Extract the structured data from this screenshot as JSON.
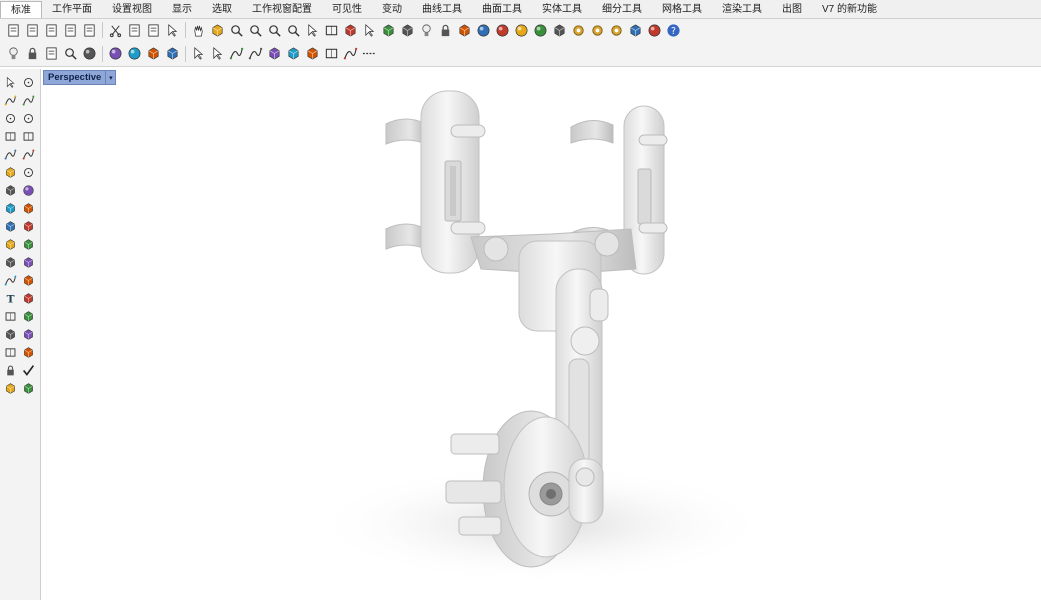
{
  "menu_tabs": [
    {
      "label": "标准",
      "active": true
    },
    {
      "label": "工作平面"
    },
    {
      "label": "设置视图"
    },
    {
      "label": "显示"
    },
    {
      "label": "选取"
    },
    {
      "label": "工作视窗配置"
    },
    {
      "label": "可见性"
    },
    {
      "label": "变动"
    },
    {
      "label": "曲线工具"
    },
    {
      "label": "曲面工具"
    },
    {
      "label": "实体工具"
    },
    {
      "label": "细分工具"
    },
    {
      "label": "网格工具"
    },
    {
      "label": "渲染工具"
    },
    {
      "label": "出图"
    },
    {
      "label": "V7 的新功能"
    }
  ],
  "toolbar_row1": [
    "new-file-icon",
    "open-file-icon",
    "save-icon",
    "print-icon",
    "import-icon",
    "cut-icon",
    "copy-icon",
    "paste-icon",
    "undo-icon",
    "pan-hand-icon",
    "rotate-view-icon",
    "zoom-icon",
    "zoom-window-icon",
    "zoom-extents-icon",
    "zoom-selected-icon",
    "undo-view-icon",
    "four-viewports-icon",
    "car-icon",
    "select-points-icon",
    "cplane-icon",
    "snap-icon",
    "light-bulb-icon",
    "lock-icon",
    "layer-icon",
    "color-wheel-icon",
    "sphere-icon",
    "shaded-sphere-icon",
    "render-sphere-icon",
    "material-icon",
    "gear-icon",
    "gear-options-icon",
    "gear-settings-icon",
    "dimension-icon",
    "globe-icon",
    "help-icon"
  ],
  "toolbar_row2": [
    "light-bulb-icon",
    "lock-icon",
    "save-icon",
    "zoom-extents-icon",
    "sphere-icon",
    "render-sphere-icon",
    "color-wheel-icon",
    "cube-group-icon",
    "render-icon",
    "arrow-left-icon",
    "arrow-swap-icon",
    "curve-icon",
    "sketch-icon",
    "surface-icon",
    "flag-icon",
    "wireframe-icon",
    "layout-icon",
    "pen-icon",
    "dotted-line-icon"
  ],
  "sidebar_tools": [
    "select-arrow-icon",
    "point-icon",
    "polyline-icon",
    "curve-points-icon",
    "circle-icon",
    "ellipse-icon",
    "polygon-icon",
    "rectangle-icon",
    "arc-icon",
    "freeform-icon",
    "extrude-icon",
    "revolve-icon",
    "box-icon",
    "sphere-tool-icon",
    "cylinder-icon",
    "plane-icon",
    "boolean-icon",
    "explode-icon",
    "fillet-icon",
    "chamfer-icon",
    "paint-icon",
    "drop-icon",
    "trim-icon",
    "split-icon",
    "text-icon",
    "dimension-tool-icon",
    "array-icon",
    "transform-icon",
    "gumball-icon",
    "analyze-icon",
    "grid-icon",
    "measure-icon",
    "block-icon",
    "check-icon",
    "mesh-icon",
    "render-tool-icon"
  ],
  "viewport": {
    "label": "Perspective",
    "dropdown": "▾"
  },
  "colors": {
    "viewport_label_bg": "#8fa7d8",
    "model": "#ededed"
  }
}
